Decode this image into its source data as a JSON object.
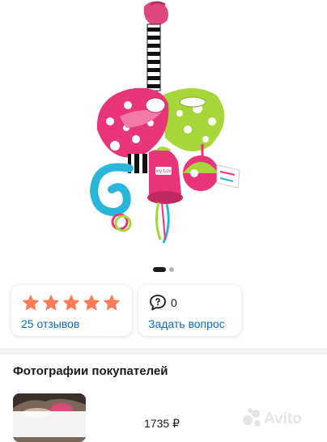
{
  "gallery": {
    "image_alt": "toy",
    "current_slide": 1,
    "total_slides": 2,
    "brand_tag_text": "Tiny Love"
  },
  "reviews": {
    "stars": 5,
    "count_label": "25 отзывов",
    "star_color": "#ff7a59"
  },
  "questions": {
    "count": "0",
    "ask_label": "Задать вопрос"
  },
  "photos": {
    "title": "Фотографии покупателей"
  },
  "bottom": {
    "price": "1735 ₽"
  },
  "watermark": {
    "text": "Avito"
  },
  "colors": {
    "link": "#0a69c9",
    "divider": "#f2f2f2"
  }
}
